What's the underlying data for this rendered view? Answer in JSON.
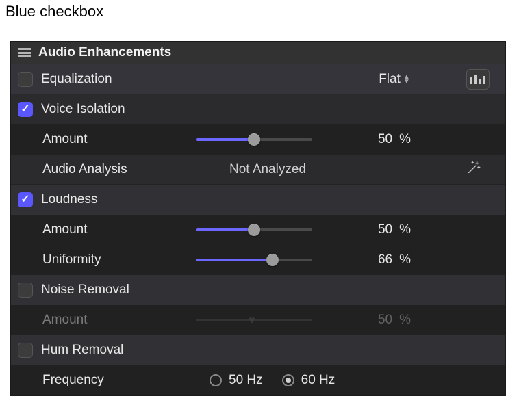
{
  "callout": {
    "text": "Blue checkbox"
  },
  "panel": {
    "title": "Audio Enhancements",
    "equalization": {
      "label": "Equalization",
      "checked": false,
      "preset": "Flat"
    },
    "voice_isolation": {
      "label": "Voice Isolation",
      "checked": true,
      "amount": {
        "label": "Amount",
        "value": 50,
        "percent": "50",
        "unit": "%"
      },
      "analysis": {
        "label": "Audio Analysis",
        "status": "Not Analyzed"
      }
    },
    "loudness": {
      "label": "Loudness",
      "checked": true,
      "amount": {
        "label": "Amount",
        "value": 50,
        "percent": "50",
        "unit": "%"
      },
      "uniformity": {
        "label": "Uniformity",
        "value": 66,
        "percent": "66",
        "unit": "%"
      }
    },
    "noise_removal": {
      "label": "Noise Removal",
      "checked": false,
      "amount": {
        "label": "Amount",
        "value": 50,
        "percent": "50",
        "unit": "%"
      }
    },
    "hum_removal": {
      "label": "Hum Removal",
      "checked": false,
      "frequency": {
        "label": "Frequency",
        "options": [
          {
            "label": "50 Hz",
            "selected": false
          },
          {
            "label": "60 Hz",
            "selected": true
          }
        ]
      }
    }
  }
}
